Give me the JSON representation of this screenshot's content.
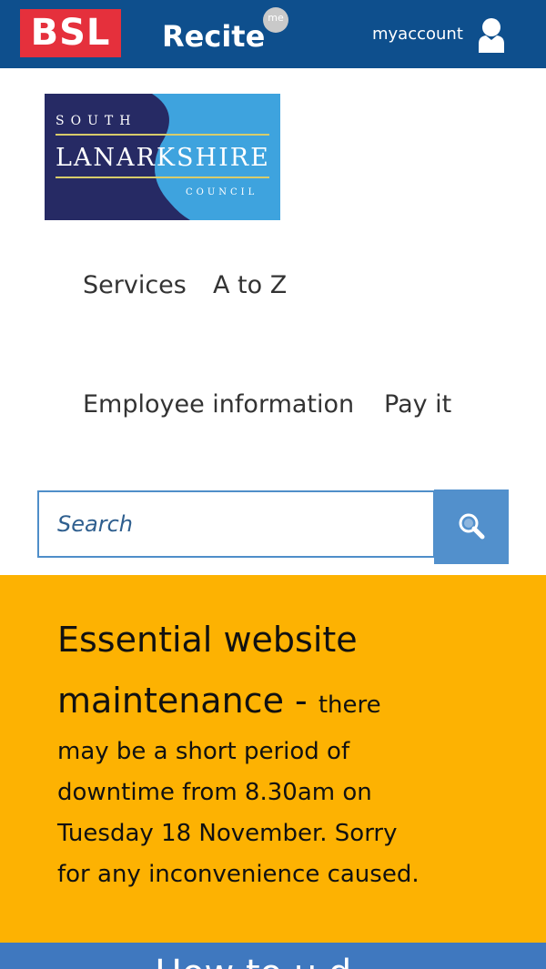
{
  "topbar": {
    "bsl_label": "BSL",
    "recite_label": "Recite",
    "recite_badge": "me",
    "account_label": "myaccount",
    "colors": {
      "background": "#0e4f8d",
      "bsl": "#e5303c"
    }
  },
  "logo": {
    "line1": "SOUTH",
    "line2": "LANARKSHIRE",
    "line3": "COUNCIL"
  },
  "nav": {
    "items": [
      {
        "label": "Services"
      },
      {
        "label": "A to Z"
      },
      {
        "label": "Employee information"
      },
      {
        "label": "Pay it"
      }
    ]
  },
  "search": {
    "placeholder": "Search",
    "button_icon": "search-icon"
  },
  "notice": {
    "title": "Essential website maintenance",
    "separator": " - ",
    "body": "there may be a short period of downtime from 8.30am on Tuesday 18 November. Sorry for any inconvenience caused.",
    "background": "#fdb202"
  },
  "bottom": {
    "partial_text": "How to u  d",
    "background": "#3f78bf"
  }
}
